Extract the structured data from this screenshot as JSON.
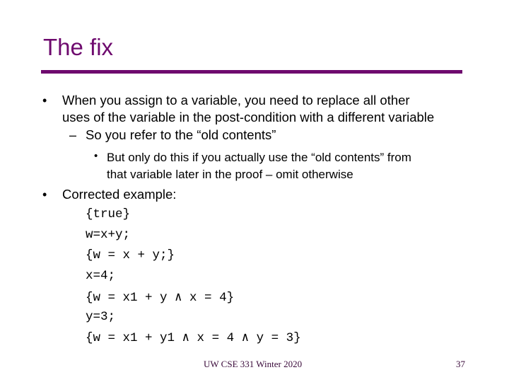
{
  "slide": {
    "title": "The fix",
    "bullets": [
      {
        "marker": "•",
        "lines": [
          "When you assign to a variable, you need to replace all other",
          "uses of the variable in the post-condition with a different variable"
        ]
      },
      {
        "marker": "–",
        "lines": [
          "So you refer to the “old contents”"
        ]
      },
      {
        "marker": "•",
        "lines": [
          "But only do this if you actually use the “old contents” from",
          "that variable later in the proof – omit otherwise"
        ]
      },
      {
        "marker": "•",
        "lines": [
          "Corrected example:"
        ]
      }
    ],
    "code_lines": [
      "{true}",
      "w=x+y;",
      "{w = x + y;}",
      "x=4;",
      "{w = x1 + y ∧ x = 4}",
      "y=3;",
      "{w = x1 + y1 ∧ x = 4 ∧ y = 3}"
    ],
    "footer": {
      "course": "UW CSE 331 Winter 2020",
      "page_number": "37"
    },
    "colors": {
      "accent": "#6e0a6e"
    }
  }
}
